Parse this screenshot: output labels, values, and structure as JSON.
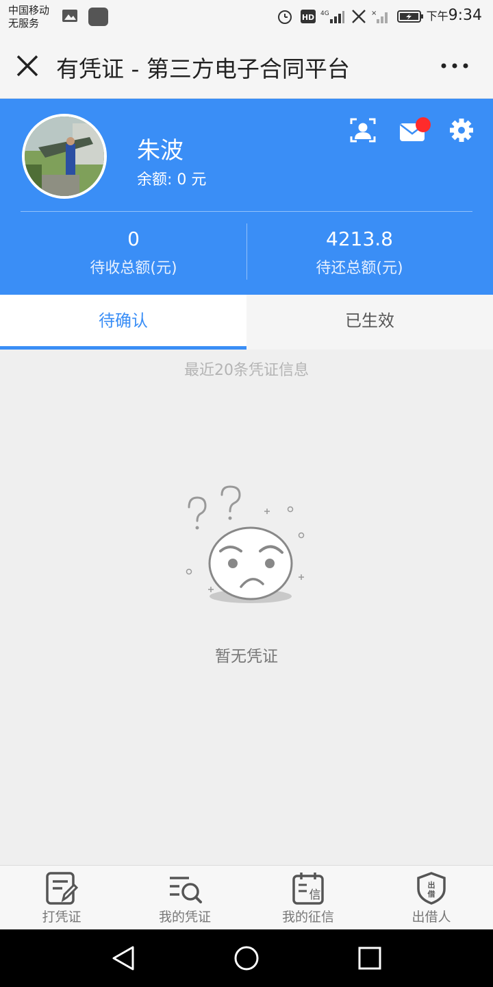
{
  "status_bar": {
    "carrier_line1": "中国移动",
    "carrier_line2": "无服务",
    "time_prefix": "下午",
    "time": "9:34",
    "network": "4G",
    "hd": "HD"
  },
  "header": {
    "title": "有凭证 - 第三方电子合同平台"
  },
  "profile": {
    "name": "朱波",
    "balance": "余额: 0 元",
    "stats": [
      {
        "value": "0",
        "label": "待收总额(元)"
      },
      {
        "value": "4213.8",
        "label": "待还总额(元)"
      }
    ]
  },
  "tabs": [
    {
      "label": "待确认",
      "active": true
    },
    {
      "label": "已生效",
      "active": false
    }
  ],
  "main": {
    "hint": "最近20条凭证信息",
    "empty_text": "暂无凭证"
  },
  "bottom_nav": [
    {
      "label": "打凭证",
      "icon": "write-receipt-icon"
    },
    {
      "label": "我的凭证",
      "icon": "search-list-icon"
    },
    {
      "label": "我的征信",
      "icon": "credit-calendar-icon"
    },
    {
      "label": "出借人",
      "icon": "lender-shield-icon",
      "icon_text": "出借"
    }
  ],
  "colors": {
    "accent": "#3a8ef6",
    "badge": "#ff2b2b"
  }
}
